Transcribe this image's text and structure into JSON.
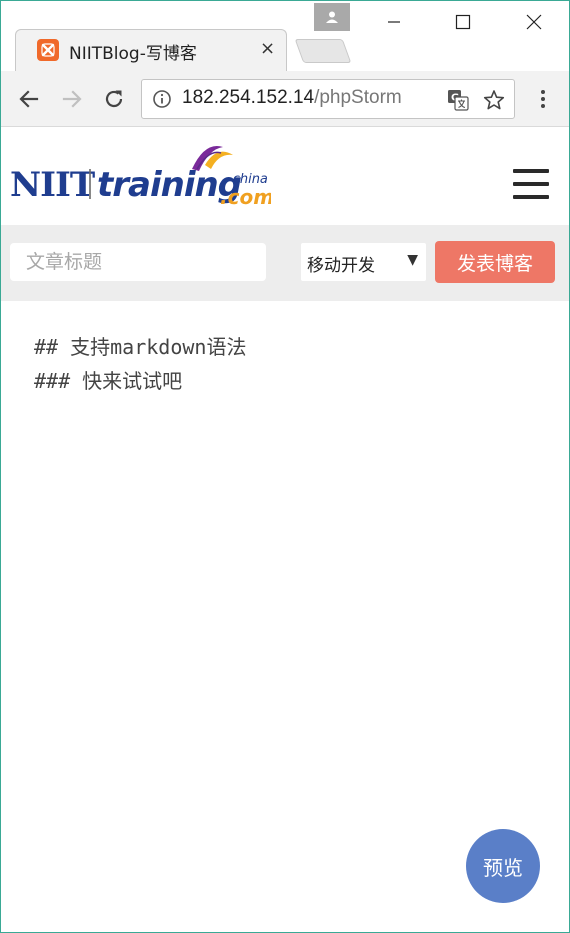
{
  "browser": {
    "tab": {
      "title": "NIITBlog-写博客",
      "close_label": "×",
      "favicon": "xampp-icon"
    },
    "address_bar": {
      "url_host": "182.254.152.14",
      "url_path": "/phpStorm"
    },
    "icons": {
      "back": "back-arrow-icon",
      "forward": "forward-arrow-icon",
      "reload": "reload-icon",
      "info": "info-icon",
      "translate": "translate-icon",
      "bookmark": "star-icon",
      "menu": "kebab-menu-icon",
      "profile": "profile-icon"
    }
  },
  "site": {
    "logo": {
      "brand": "NIIT",
      "word": "training",
      "suffix_top": "-china",
      "suffix_bottom": ".com",
      "colors": {
        "niit": "#1f3d8f",
        "training": "#1f3d8f",
        "com": "#f0a020",
        "swoosh_purple": "#7a2a9a",
        "swoosh_yellow": "#f4b021"
      }
    },
    "menu_icon": "hamburger-icon"
  },
  "compose": {
    "title_placeholder": "文章标题",
    "category_selected": "移动开发",
    "publish_label": "发表博客",
    "publish_color": "#ee7766"
  },
  "editor": {
    "lines": [
      "## 支持markdown语法",
      "### 快来试试吧"
    ]
  },
  "preview": {
    "label": "预览",
    "color": "#5a7fc8"
  }
}
